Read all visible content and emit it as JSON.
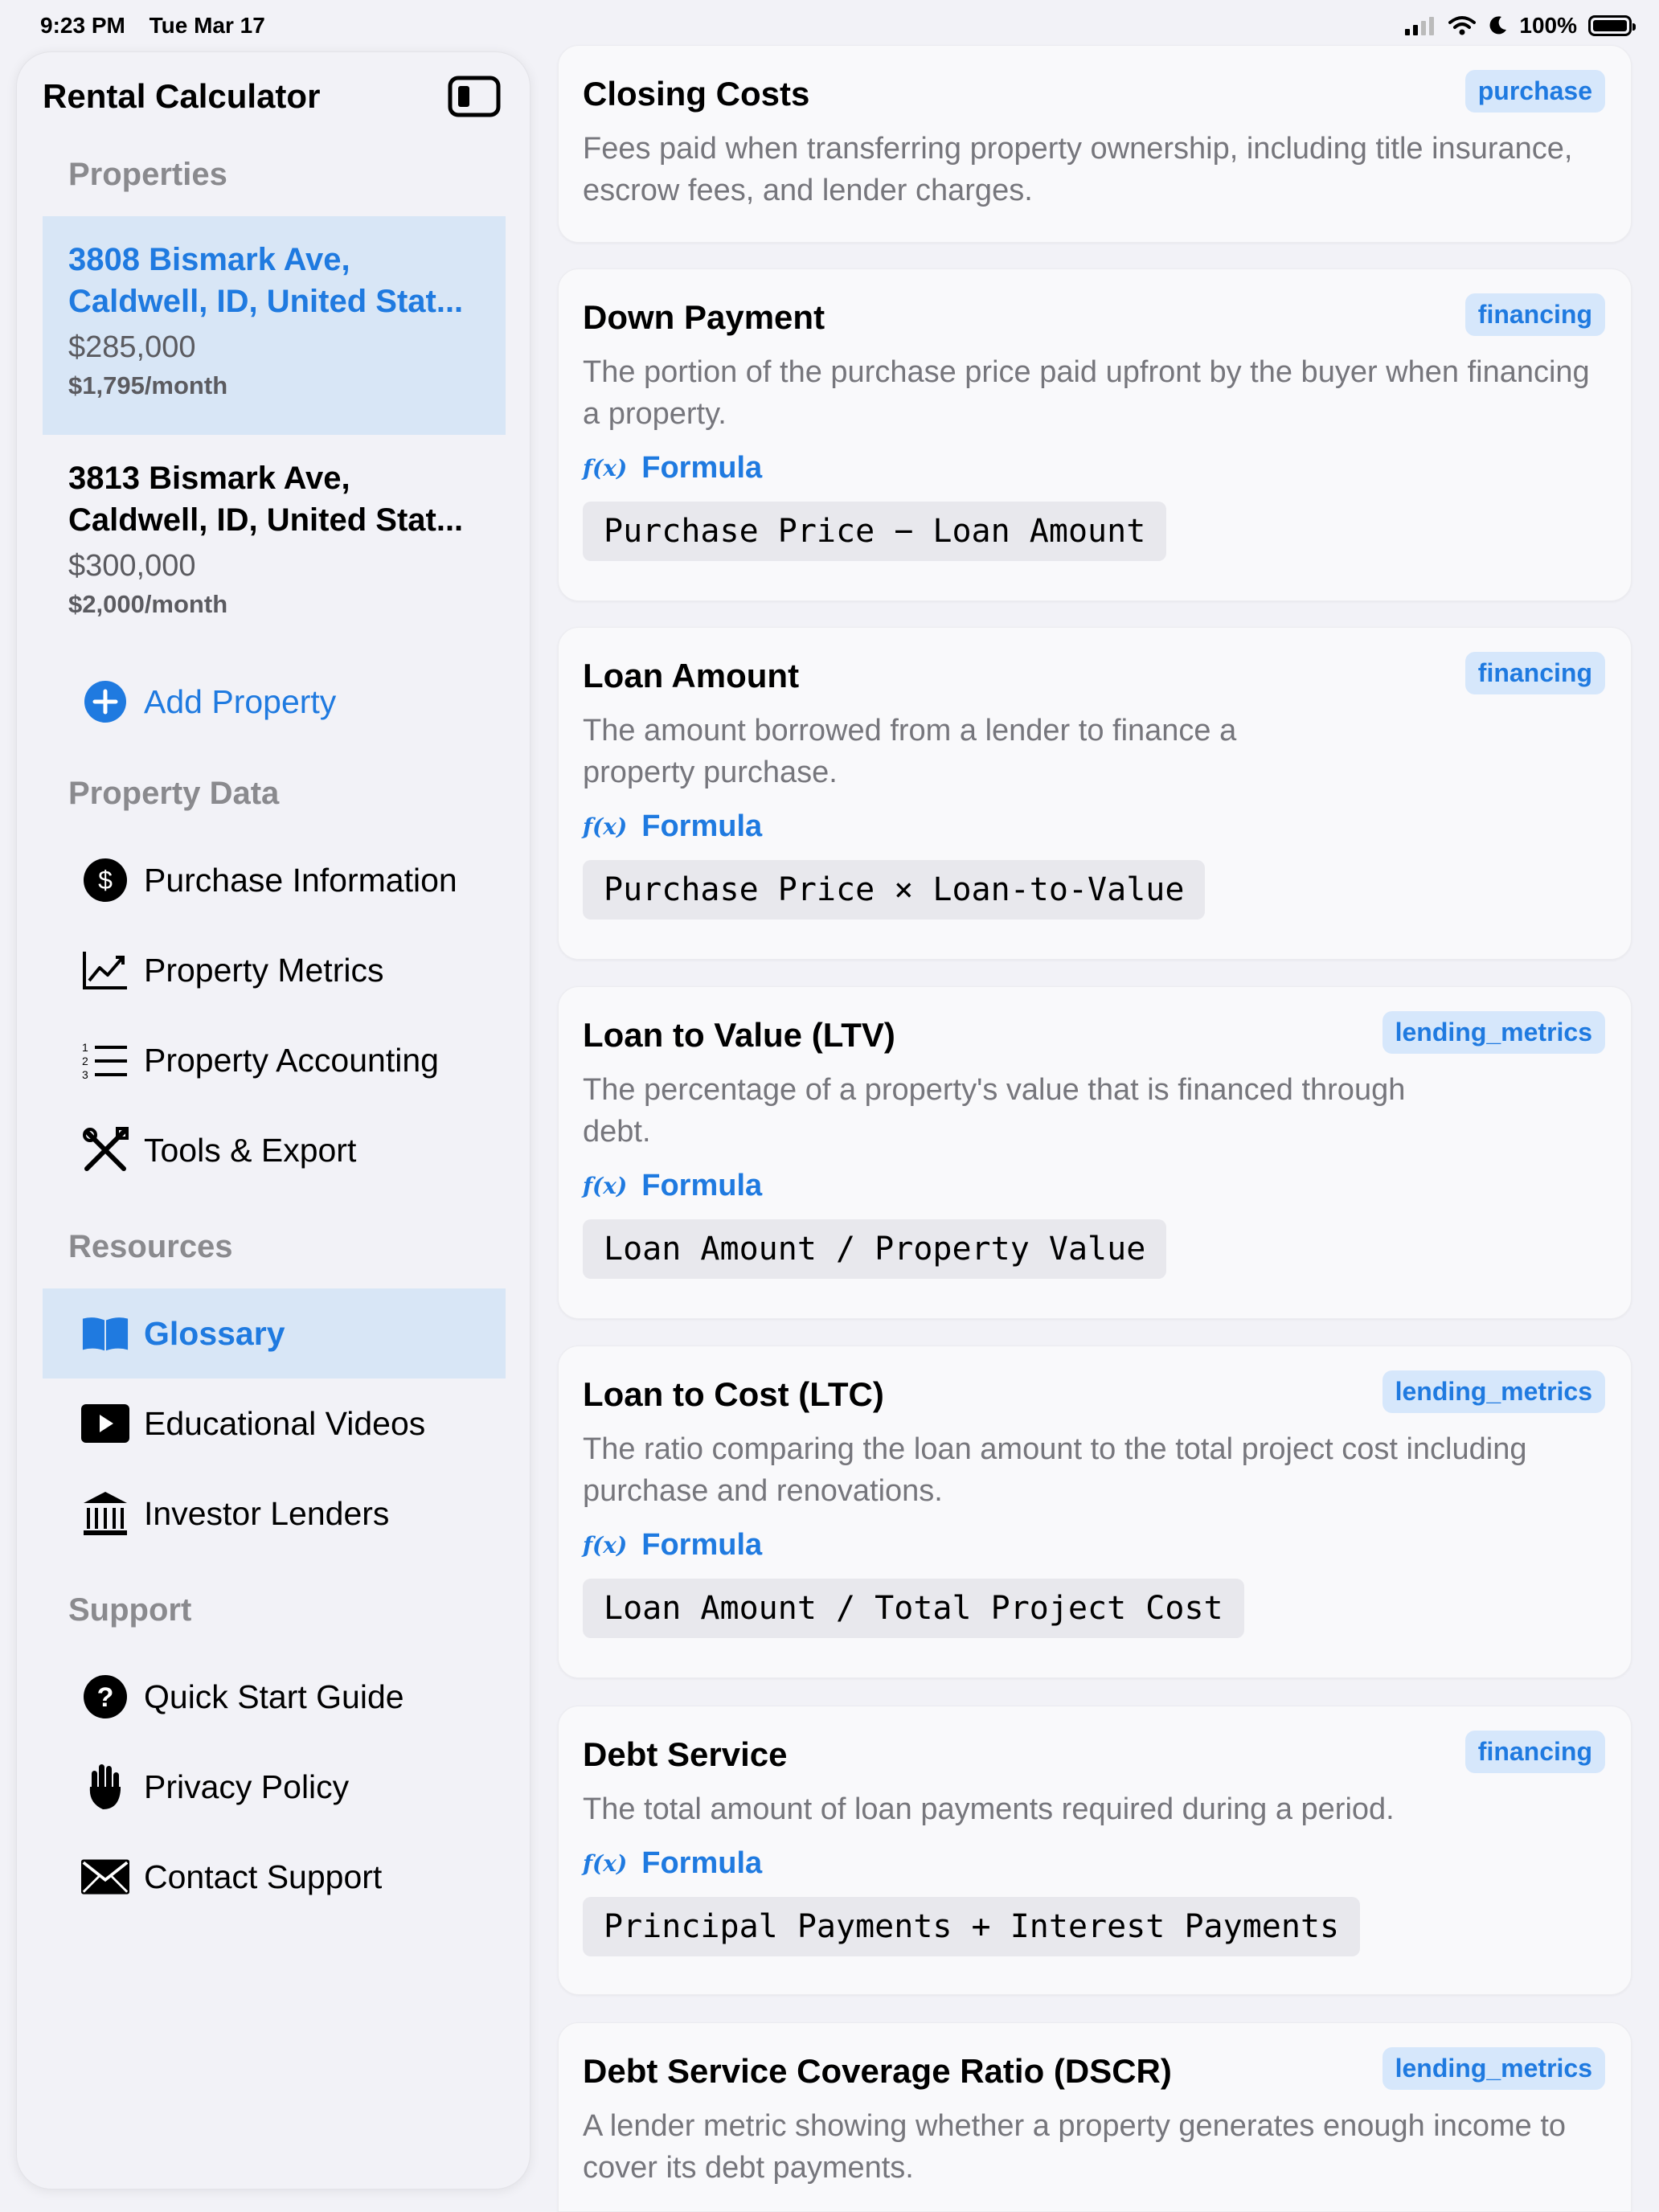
{
  "status": {
    "time": "9:23 PM",
    "date": "Tue Mar 17",
    "battery": "100%"
  },
  "sidebar": {
    "app_title": "Rental Calculator",
    "sections": {
      "properties": "Properties",
      "property_data": "Property Data",
      "resources": "Resources",
      "support": "Support"
    },
    "properties": [
      {
        "address": "3808 Bismark Ave, Caldwell, ID, United Stat...",
        "price": "$285,000",
        "rent": "$1,795/month"
      },
      {
        "address": "3813 Bismark Ave, Caldwell, ID, United Stat...",
        "price": "$300,000",
        "rent": "$2,000/month"
      }
    ],
    "add_property": "Add Property",
    "property_data_items": [
      "Purchase Information",
      "Property Metrics",
      "Property Accounting",
      "Tools & Export"
    ],
    "resources_items": [
      "Glossary",
      "Educational Videos",
      "Investor Lenders"
    ],
    "support_items": [
      "Quick Start Guide",
      "Privacy Policy",
      "Contact Support"
    ]
  },
  "formula_label": "Formula",
  "fx_glyph": "f(x)",
  "terms": [
    {
      "title": "Closing Costs",
      "tag": "purchase",
      "description": "Fees paid when transferring property ownership, including title insurance, escrow fees, and lender charges."
    },
    {
      "title": "Down Payment",
      "tag": "financing",
      "description": "The portion of the purchase price paid upfront by the buyer when financing a property.",
      "formula": "Purchase Price − Loan Amount"
    },
    {
      "title": "Loan Amount",
      "tag": "financing",
      "description": "The amount borrowed from a lender to finance a property purchase.",
      "formula": "Purchase Price × Loan-to-Value"
    },
    {
      "title": "Loan to Value (LTV)",
      "tag": "lending_metrics",
      "description": "The percentage of a property's value that is financed through debt.",
      "formula": "Loan Amount / Property Value"
    },
    {
      "title": "Loan to Cost (LTC)",
      "tag": "lending_metrics",
      "description": "The ratio comparing the loan amount to the total project cost including purchase and renovations.",
      "formula": "Loan Amount / Total Project Cost"
    },
    {
      "title": "Debt Service",
      "tag": "financing",
      "description": "The total amount of loan payments required during a period.",
      "formula": "Principal Payments + Interest Payments"
    },
    {
      "title": "Debt Service Coverage Ratio (DSCR)",
      "tag": "lending_metrics",
      "description": "A lender metric showing whether a property generates enough income to cover its debt payments."
    }
  ]
}
